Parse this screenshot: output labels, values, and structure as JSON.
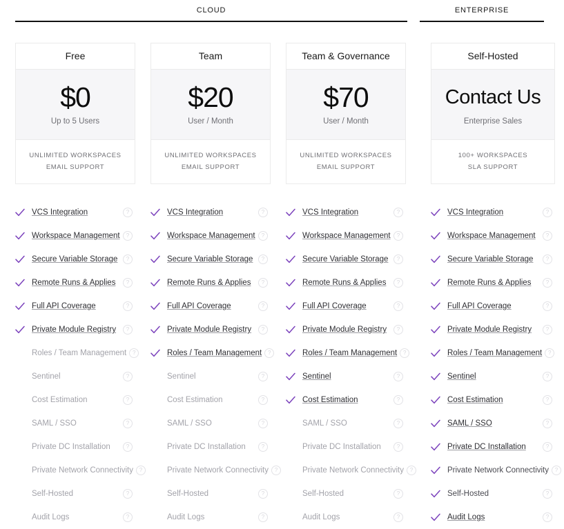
{
  "colors": {
    "check": "#7b42bc",
    "card_border": "#ebebeb",
    "price_band_bg": "#f6f6f8",
    "muted_text": "#a3a3aa",
    "active_text": "#2e2e33",
    "rule": "#111111"
  },
  "sections": [
    {
      "id": "cloud",
      "label": "CLOUD"
    },
    {
      "id": "enterprise",
      "label": "ENTERPRISE"
    }
  ],
  "help_icon_glyph": "?",
  "check_icon_name": "check-icon",
  "plans": [
    {
      "name": "Free",
      "price": "$0",
      "price_sub": "Up to 5 Users",
      "price_size": "large",
      "footer": [
        "UNLIMITED WORKSPACES",
        "EMAIL SUPPORT"
      ]
    },
    {
      "name": "Team",
      "price": "$20",
      "price_sub": "User / Month",
      "price_size": "large",
      "footer": [
        "UNLIMITED WORKSPACES",
        "EMAIL SUPPORT"
      ]
    },
    {
      "name": "Team & Governance",
      "price": "$70",
      "price_sub": "User / Month",
      "price_size": "large",
      "footer": [
        "UNLIMITED WORKSPACES",
        "EMAIL SUPPORT"
      ]
    },
    {
      "name": "Self-Hosted",
      "price": "Contact Us",
      "price_sub": "Enterprise Sales",
      "price_size": "small",
      "footer": [
        "100+ WORKSPACES",
        "SLA SUPPORT"
      ]
    }
  ],
  "features": [
    "VCS Integration",
    "Workspace Management",
    "Secure Variable Storage",
    "Remote Runs & Applies",
    "Full API Coverage",
    "Private Module Registry",
    "Roles / Team Management",
    "Sentinel",
    "Cost Estimation",
    "SAML / SSO",
    "Private DC Installation",
    "Private Network Connectivity",
    "Self-Hosted",
    "Audit Logs"
  ],
  "matrix": [
    {
      "plan": "Free",
      "rows": [
        {
          "label": "VCS Integration",
          "checked": true,
          "style": "active"
        },
        {
          "label": "Workspace Management",
          "checked": true,
          "style": "active"
        },
        {
          "label": "Secure Variable Storage",
          "checked": true,
          "style": "active"
        },
        {
          "label": "Remote Runs & Applies",
          "checked": true,
          "style": "active"
        },
        {
          "label": "Full API Coverage",
          "checked": true,
          "style": "active"
        },
        {
          "label": "Private Module Registry",
          "checked": true,
          "style": "active"
        },
        {
          "label": "Roles / Team Management",
          "checked": false,
          "style": "inactive"
        },
        {
          "label": "Sentinel",
          "checked": false,
          "style": "inactive"
        },
        {
          "label": "Cost Estimation",
          "checked": false,
          "style": "inactive"
        },
        {
          "label": "SAML / SSO",
          "checked": false,
          "style": "inactive"
        },
        {
          "label": "Private DC Installation",
          "checked": false,
          "style": "inactive"
        },
        {
          "label": "Private Network Connectivity",
          "checked": false,
          "style": "inactive"
        },
        {
          "label": "Self-Hosted",
          "checked": false,
          "style": "inactive"
        },
        {
          "label": "Audit Logs",
          "checked": false,
          "style": "inactive"
        }
      ]
    },
    {
      "plan": "Team",
      "rows": [
        {
          "label": "VCS Integration",
          "checked": true,
          "style": "active"
        },
        {
          "label": "Workspace Management",
          "checked": true,
          "style": "active"
        },
        {
          "label": "Secure Variable Storage",
          "checked": true,
          "style": "active"
        },
        {
          "label": "Remote Runs & Applies",
          "checked": true,
          "style": "active"
        },
        {
          "label": "Full API Coverage",
          "checked": true,
          "style": "active"
        },
        {
          "label": "Private Module Registry",
          "checked": true,
          "style": "active"
        },
        {
          "label": "Roles / Team Management",
          "checked": true,
          "style": "active"
        },
        {
          "label": "Sentinel",
          "checked": false,
          "style": "inactive"
        },
        {
          "label": "Cost Estimation",
          "checked": false,
          "style": "inactive"
        },
        {
          "label": "SAML / SSO",
          "checked": false,
          "style": "inactive"
        },
        {
          "label": "Private DC Installation",
          "checked": false,
          "style": "inactive"
        },
        {
          "label": "Private Network Connectivity",
          "checked": false,
          "style": "inactive"
        },
        {
          "label": "Self-Hosted",
          "checked": false,
          "style": "inactive"
        },
        {
          "label": "Audit Logs",
          "checked": false,
          "style": "inactive"
        }
      ]
    },
    {
      "plan": "Team & Governance",
      "rows": [
        {
          "label": "VCS Integration",
          "checked": true,
          "style": "active"
        },
        {
          "label": "Workspace Management",
          "checked": true,
          "style": "active"
        },
        {
          "label": "Secure Variable Storage",
          "checked": true,
          "style": "active"
        },
        {
          "label": "Remote Runs & Applies",
          "checked": true,
          "style": "active"
        },
        {
          "label": "Full API Coverage",
          "checked": true,
          "style": "active"
        },
        {
          "label": "Private Module Registry",
          "checked": true,
          "style": "active"
        },
        {
          "label": "Roles / Team Management",
          "checked": true,
          "style": "active"
        },
        {
          "label": "Sentinel",
          "checked": true,
          "style": "active"
        },
        {
          "label": "Cost Estimation",
          "checked": true,
          "style": "active"
        },
        {
          "label": "SAML / SSO",
          "checked": false,
          "style": "inactive"
        },
        {
          "label": "Private DC Installation",
          "checked": false,
          "style": "inactive"
        },
        {
          "label": "Private Network Connectivity",
          "checked": false,
          "style": "inactive"
        },
        {
          "label": "Self-Hosted",
          "checked": false,
          "style": "inactive"
        },
        {
          "label": "Audit Logs",
          "checked": false,
          "style": "inactive"
        }
      ]
    },
    {
      "plan": "Self-Hosted",
      "rows": [
        {
          "label": "VCS Integration",
          "checked": true,
          "style": "active"
        },
        {
          "label": "Workspace Management",
          "checked": true,
          "style": "active"
        },
        {
          "label": "Secure Variable Storage",
          "checked": true,
          "style": "active"
        },
        {
          "label": "Remote Runs & Applies",
          "checked": true,
          "style": "active"
        },
        {
          "label": "Full API Coverage",
          "checked": true,
          "style": "active"
        },
        {
          "label": "Private Module Registry",
          "checked": true,
          "style": "active"
        },
        {
          "label": "Roles / Team Management",
          "checked": true,
          "style": "active"
        },
        {
          "label": "Sentinel",
          "checked": true,
          "style": "active"
        },
        {
          "label": "Cost Estimation",
          "checked": true,
          "style": "active"
        },
        {
          "label": "SAML / SSO",
          "checked": true,
          "style": "active"
        },
        {
          "label": "Private DC Installation",
          "checked": true,
          "style": "active"
        },
        {
          "label": "Private Network Connectivity",
          "checked": true,
          "style": "plain"
        },
        {
          "label": "Self-Hosted",
          "checked": true,
          "style": "plain"
        },
        {
          "label": "Audit Logs",
          "checked": true,
          "style": "active"
        }
      ]
    }
  ]
}
